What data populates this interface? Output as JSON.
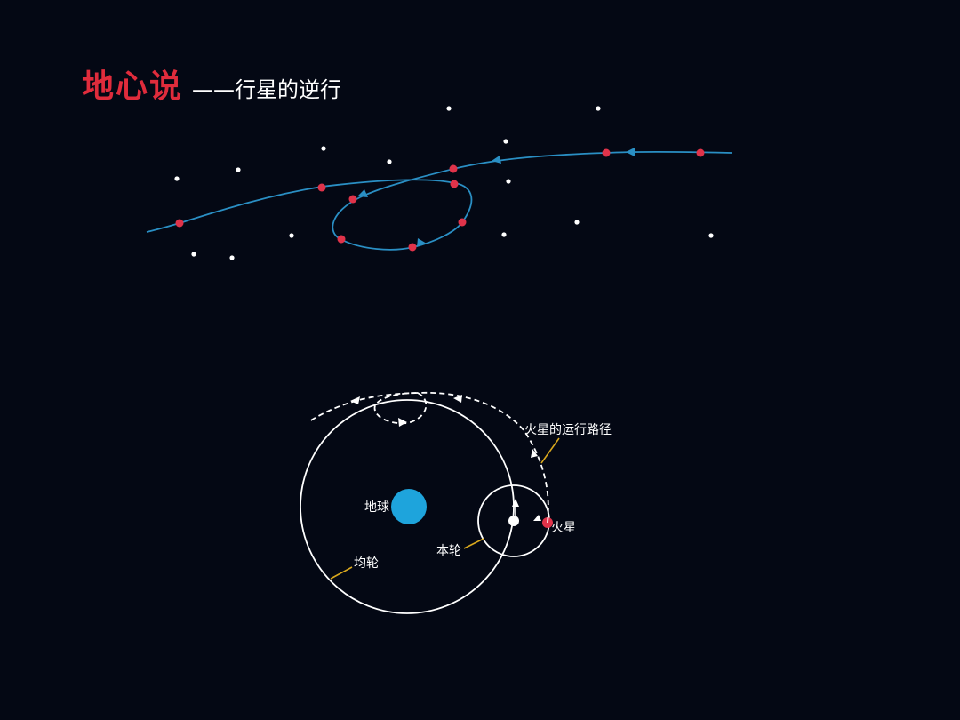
{
  "title": {
    "main": "地心说",
    "sub": "——行星的逆行"
  },
  "colors": {
    "background": "#040814",
    "title_red": "#e02c3c",
    "path_blue": "#2a8fc4",
    "mars_red": "#e0334a",
    "earth_blue": "#1ea4dc",
    "leader_yellow": "#d9a81e"
  },
  "labels": {
    "earth": "地球",
    "mars": "火星",
    "epicycle": "本轮",
    "deferent": "均轮",
    "mars_path": "火星的运行路径"
  }
}
